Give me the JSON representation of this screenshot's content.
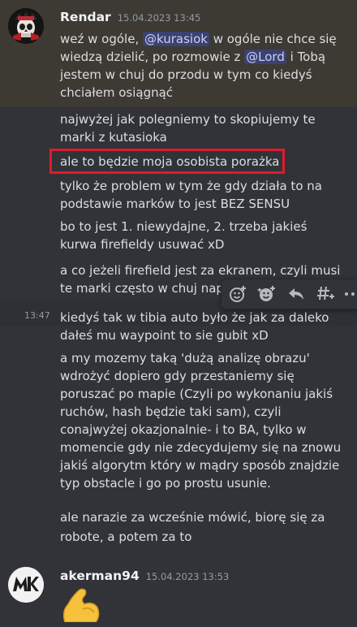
{
  "message1": {
    "author": "Rendar",
    "timestamp": "15.04.2023 13:45",
    "line1_pre": "weź w ogóle,",
    "mention1": "@kurasiok",
    "line1_post": " w ogóle nie chce się",
    "line2_pre": "wiedzą dzielić, po rozmowie z ",
    "mention2": "@Lord",
    "line2_post": " i Tobą",
    "line3": "jestem w chuj do przodu w tym co kiedyś",
    "line4": "chciałem osiągnąć"
  },
  "followups": [
    {
      "lines": [
        "najwyżej jak polegniemy to skopiujemy te",
        "marki z kutasioka"
      ]
    },
    {
      "lines": [
        "ale to będzie moja osobista porażka"
      ]
    },
    {
      "lines": [
        "tylko że problem w tym że gdy działa to na",
        "podstawie marków to jest BEZ SENSU"
      ]
    },
    {
      "lines": [
        "bo to jest 1. niewydajne, 2. trzeba jakieś",
        "kurwa firefieldy usuwać xD"
      ]
    },
    {
      "lines": [
        "a co jeżeli firefield jest za ekranem, czyli musi",
        "te marki często w chuj napi"
      ]
    },
    {
      "time": "13:47",
      "lines": [
        "kiedyś tak w tibia auto było że jak za daleko",
        "dałeś mu waypoint to sie gubit xD"
      ]
    },
    {
      "lines": [
        "a my mozemy taką 'dużą analizę obrazu'",
        "wdrożyć dopiero gdy przestaniemy się",
        "poruszać po mapie (Czyli po wykonaniu jakiś",
        "ruchów, hash będzie taki sam), czyli",
        "conajwyżej okazjonalnie- i to BA, tylko w",
        "momencie gdy nie zdecydujemy się na znowu",
        "jakiś algorytm który w mądry sposób znajdzie",
        "typ obstacle i go po prostu usunie."
      ]
    },
    {
      "lines": [
        "ale narazie za wcześnie mówić, biorę się za",
        "robote, a potem za to"
      ]
    }
  ],
  "message2": {
    "author": "akerman94",
    "timestamp": "15.04.2023 13:53",
    "avatar_text": "MK",
    "emoji": "flexed-biceps"
  },
  "toolbar": {
    "icons": [
      "add-reaction-icon",
      "super-reaction-icon",
      "reply-icon",
      "create-thread-icon",
      "more-icon"
    ]
  },
  "colors": {
    "background": "#313338",
    "highlight": "#3c3a33",
    "mention_bg": "#3c4270",
    "highlight_box": "#e21a2c"
  }
}
